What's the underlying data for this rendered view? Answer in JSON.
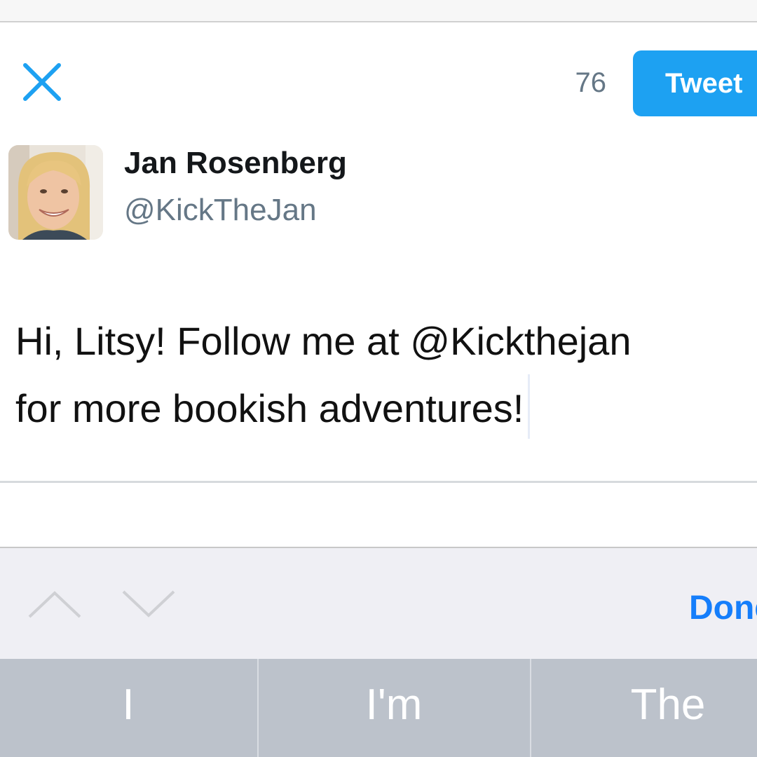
{
  "header": {
    "char_count": "76",
    "tweet_label": "Tweet",
    "close_icon": "close-icon"
  },
  "user": {
    "name": "Jan Rosenberg",
    "handle": "@KickTheJan"
  },
  "compose": {
    "text": "Hi, Litsy! Follow me at @Kickthejan\nfor more bookish adventures!"
  },
  "keyboard_toolbar": {
    "prev_icon": "chevron-up-icon",
    "next_icon": "chevron-down-icon",
    "done_label": "Done"
  },
  "suggestions": [
    "I",
    "I'm",
    "The"
  ],
  "colors": {
    "accent": "#1da1f2",
    "done_blue": "#157efb",
    "handle_gray": "#657786"
  }
}
